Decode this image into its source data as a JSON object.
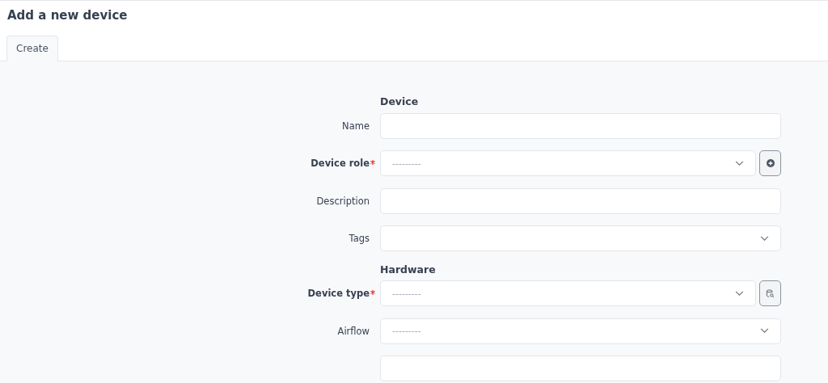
{
  "page": {
    "title": "Add a new device"
  },
  "tabs": [
    {
      "label": "Create",
      "selected": true
    }
  ],
  "sections": [
    {
      "heading": "Device",
      "fields": [
        {
          "label": "Name",
          "kind": "text",
          "required": false
        },
        {
          "label": "Device role",
          "kind": "select",
          "required": true,
          "placeholder": "---------",
          "button": {
            "kind": "add"
          }
        },
        {
          "label": "Description",
          "kind": "text",
          "required": false
        },
        {
          "label": "Tags",
          "kind": "select",
          "required": false
        }
      ]
    },
    {
      "heading": "Hardware",
      "fields": [
        {
          "label": "Device type",
          "kind": "select",
          "required": true,
          "placeholder": "---------",
          "button": {
            "kind": "selector"
          }
        },
        {
          "label": "Airflow",
          "kind": "select",
          "required": false,
          "placeholder": "---------"
        },
        {
          "kind": "text"
        }
      ]
    }
  ]
}
